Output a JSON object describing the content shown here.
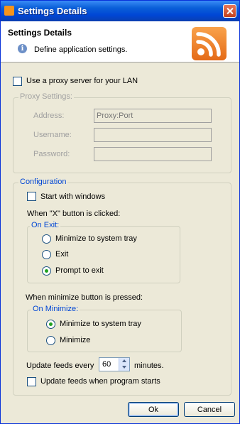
{
  "window": {
    "title": "Settings Details"
  },
  "header": {
    "title": "Settings Details",
    "subtitle": "Define application settings."
  },
  "proxy": {
    "use_proxy_label": "Use a proxy server for your LAN",
    "use_proxy_checked": false,
    "group_title": "Proxy Settings:",
    "address_label": "Address:",
    "address_placeholder": "Proxy:Port",
    "username_label": "Username:",
    "password_label": "Password:"
  },
  "configuration": {
    "group_title": "Configuration",
    "start_with_windows_label": "Start with windows",
    "start_with_windows_checked": false,
    "x_button_label": "When \"X\" button is clicked:",
    "on_exit": {
      "title": "On Exit:",
      "options": [
        "Minimize to system tray",
        "Exit",
        "Prompt to exit"
      ],
      "selected": "Prompt to exit"
    },
    "minimize_button_label": "When minimize button is pressed:",
    "on_minimize": {
      "title": "On Minimize:",
      "options": [
        "Minimize to system tray",
        "Minimize"
      ],
      "selected": "Minimize to system tray"
    },
    "update_feeds_prefix": "Update feeds every",
    "update_feeds_value": "60",
    "update_feeds_suffix": "minutes.",
    "update_on_start_label": "Update feeds when program starts",
    "update_on_start_checked": false
  },
  "buttons": {
    "ok": "Ok",
    "cancel": "Cancel"
  },
  "colors": {
    "titlebar": "#0a5fd8",
    "dialog_bg": "#ece9d8",
    "legend_text": "#0046d5",
    "radio_selected": "#21a121",
    "rss_orange": "#f7941d"
  },
  "icons": {
    "title": "rss-icon",
    "close": "close-icon",
    "info": "info-icon",
    "header": "rss-feed-icon"
  }
}
